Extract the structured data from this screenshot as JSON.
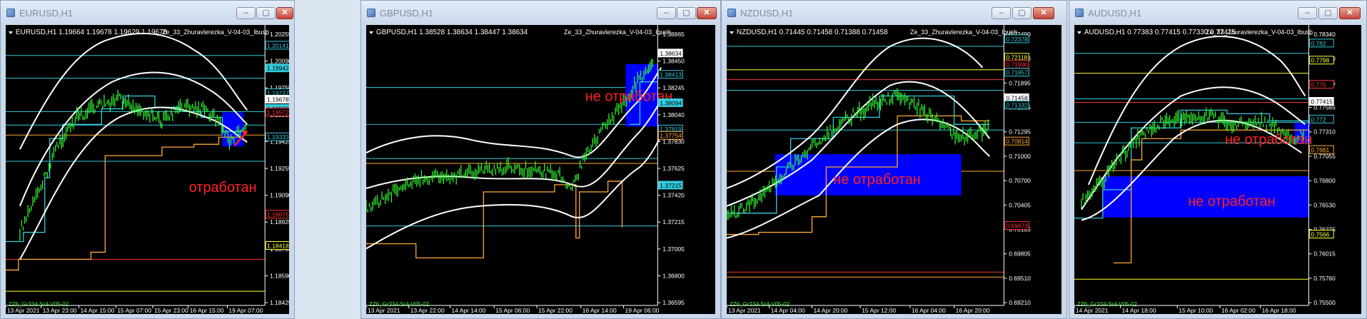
{
  "windows": [
    {
      "title": "EURUSD,H1",
      "symbol_info": "EURUSD,H1  1.19664 1.19678 1.19629 1.19678",
      "indicator": "Ze_33_Zhuravlerezka_V-04-03_Ibush",
      "bottom_label": "ZZ6_Gr334-Sr4-V05-02",
      "y_ticks": [
        "1.20255",
        "1.20090",
        "1.19755",
        "1.19590",
        "1.19425",
        "1.19255",
        "1.19090",
        "1.18925",
        "1.18760",
        "1.18590",
        "1.18425"
      ],
      "price_labels": [
        {
          "text": "1.20141",
          "color": "#33ccdd",
          "bg": "#000000"
        },
        {
          "text": "1.19942",
          "color": "#000000",
          "bg": "#33ccdd"
        },
        {
          "text": "1.19737",
          "color": "#33ccdd",
          "bg": "#000000"
        },
        {
          "text": "1.19678",
          "color": "#000000",
          "bg": "#ffffff"
        },
        {
          "text": "1.19595",
          "color": "#000000",
          "bg": "#33ccdd"
        },
        {
          "text": "1.19572",
          "color": "#ff3333",
          "bg": "#000000"
        },
        {
          "text": "1.19333",
          "color": "#33ccdd",
          "bg": "#000000"
        },
        {
          "text": "1.18676",
          "color": "#ff3333",
          "bg": "#000000"
        },
        {
          "text": "1.18418",
          "color": "#ffff33",
          "bg": "#000000"
        }
      ],
      "x_ticks": [
        "13 Apr 2021",
        "13 Apr 23:00",
        "14 Apr 15:00",
        "15 Apr 07:00",
        "15 Apr 23:00",
        "16 Apr 15:00",
        "19 Apr 07:00"
      ],
      "annotations": [
        "отработан"
      ]
    },
    {
      "title": "GBPUSD,H1",
      "symbol_info": "GBPUSD,H1  1.38528 1.38634 1.38447 1.38634",
      "indicator": "Ze_33_Zhuravlerezka_V-04-03_Ibush",
      "bottom_label": "ZZ6_Gr334-Sr4-V05-02",
      "y_ticks": [
        "1.38865",
        "1.38450",
        "1.38245",
        "1.38040",
        "1.37830",
        "1.37625",
        "1.37420",
        "1.37215",
        "1.37005",
        "1.36800",
        "1.36595"
      ],
      "price_labels": [
        {
          "text": "1.38634",
          "color": "#000000",
          "bg": "#ffffff"
        },
        {
          "text": "1.38413",
          "color": "#33ccdd",
          "bg": "#000000"
        },
        {
          "text": "1.38094",
          "color": "#000000",
          "bg": "#33ccdd"
        },
        {
          "text": "1.37819",
          "color": "#33ccdd",
          "bg": "#000000"
        },
        {
          "text": "1.37754",
          "color": "#ffaa33",
          "bg": "#000000"
        },
        {
          "text": "1.37215",
          "color": "#000000",
          "bg": "#33ccdd"
        }
      ],
      "x_ticks": [
        "13 Apr 2021",
        "13 Apr 22:00",
        "14 Apr 14:00",
        "15 Apr 06:00",
        "15 Apr 22:00",
        "16 Apr 14:00",
        "19 Apr 06:00"
      ],
      "annotations": [
        "не отработан"
      ]
    },
    {
      "title": "NZDUSD,H1",
      "symbol_info": "NZDUSD,H1  0.71445 0.71458 0.71388 0.71458",
      "indicator": "Ze_33_Zhuravlerezka_V-04-03_Ibush",
      "bottom_label": "ZZ6_Gr334-Sr4-V05-02",
      "y_ticks": [
        "0.72490",
        "0.72190",
        "0.71895",
        "0.71595",
        "0.71295",
        "0.71000",
        "0.70700",
        "0.70405",
        "0.70105",
        "0.69805",
        "0.69510",
        "0.69210"
      ],
      "price_labels": [
        {
          "text": "0.72378",
          "color": "#33ccdd",
          "bg": "#000000"
        },
        {
          "text": "0.72118",
          "color": "#ffff33",
          "bg": "#000000"
        },
        {
          "text": "0.71990",
          "color": "#ff3333",
          "bg": "#000000"
        },
        {
          "text": "0.71857",
          "color": "#33ccdd",
          "bg": "#000000"
        },
        {
          "text": "0.71458",
          "color": "#000000",
          "bg": "#ffffff"
        },
        {
          "text": "0.71332",
          "color": "#33ccdd",
          "bg": "#000000"
        },
        {
          "text": "0.70814",
          "color": "#ffaa33",
          "bg": "#000000"
        },
        {
          "text": "0.69473",
          "color": "#ff3333",
          "bg": "#000000"
        }
      ],
      "x_ticks": [
        "13 Apr 2021",
        "14 Apr 04:00",
        "14 Apr 20:00",
        "15 Apr 12:00",
        "16 Apr 04:00",
        "16 Apr 20:00"
      ],
      "annotations": [
        "не отработан"
      ]
    },
    {
      "title": "AUDUSD,H1",
      "symbol_info": "AUDUSD,H1  0.77383 0.77415 0.77330 0.77415",
      "indicator": "Ze_33_Zhuravlerezka_V-04-03_Ibush",
      "bottom_label": "ZZ6_Gr334-Sr4-V05-02",
      "y_ticks": [
        "0.78340",
        "0.78070",
        "0.77825",
        "0.77565",
        "0.77310",
        "0.77055",
        "0.76800",
        "0.76530",
        "0.76275",
        "0.76015",
        "0.75760",
        "0.75500"
      ],
      "price_labels": [
        {
          "text": "0.782",
          "color": "#33ccdd",
          "bg": "#000000"
        },
        {
          "text": "0.7798",
          "color": "#ffff33",
          "bg": "#000000"
        },
        {
          "text": "0.776",
          "color": "#ff3333",
          "bg": "#000000"
        },
        {
          "text": "0.77415",
          "color": "#000000",
          "bg": "#ffffff"
        },
        {
          "text": "0.772",
          "color": "#33ccdd",
          "bg": "#000000"
        },
        {
          "text": "0.7681",
          "color": "#ffaa33",
          "bg": "#000000"
        },
        {
          "text": "0.7566",
          "color": "#ffff33",
          "bg": "#000000"
        }
      ],
      "x_ticks": [
        "14 Apr 2021",
        "14 Apr 18:00",
        "15 Apr 10:00",
        "16 Apr 02:00",
        "16 Apr 18:00"
      ],
      "annotations": [
        "не отработан",
        "не отработан"
      ]
    }
  ],
  "window_controls": {
    "minimize": "‒",
    "maximize": "▢",
    "close": "✕"
  },
  "colors": {
    "candle": "#33ff33",
    "bands": "#ffffff",
    "zone": "#0000ff",
    "level_cyan": "#33ccdd",
    "level_orange": "#ffaa33",
    "level_yellow": "#ffff33",
    "level_red": "#ff3333",
    "annotation": "#ff2222",
    "axis_text": "#ffffff"
  }
}
